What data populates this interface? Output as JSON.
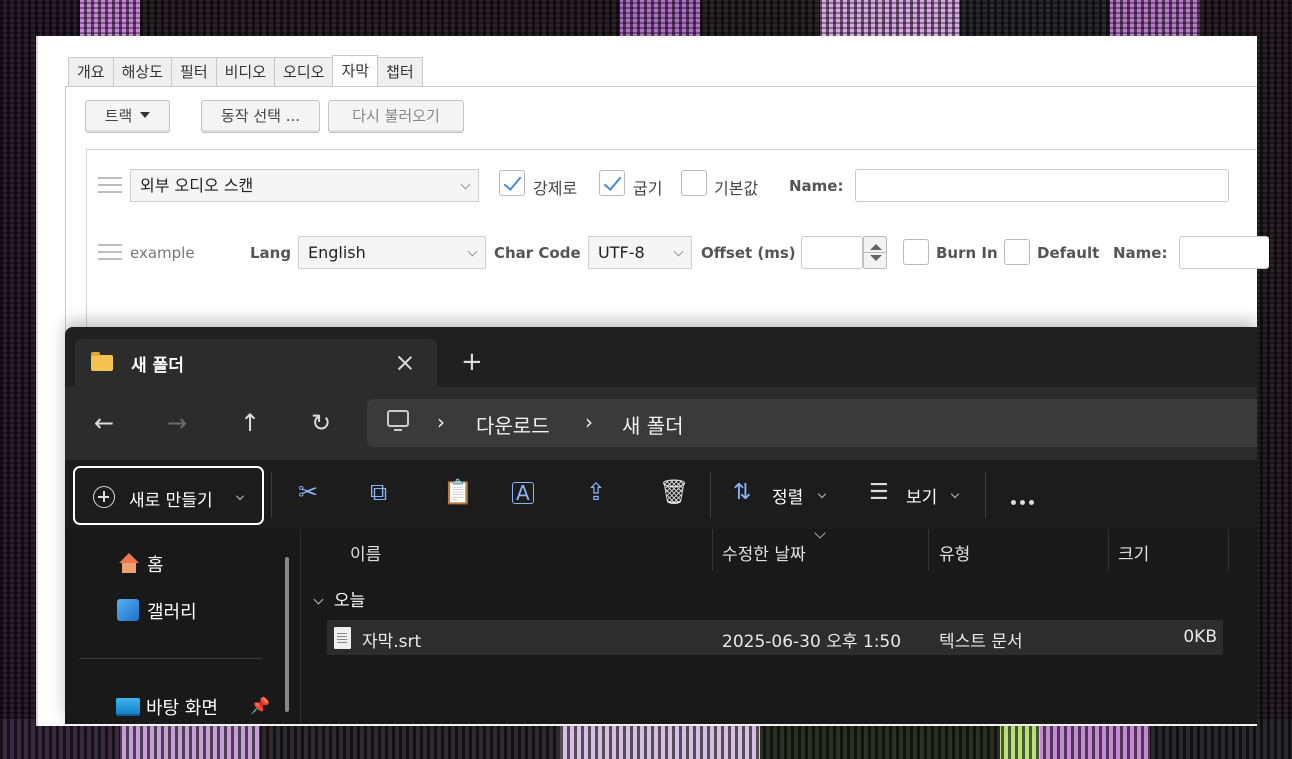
{
  "panel": {
    "tabs": [
      "개요",
      "해상도",
      "필터",
      "비디오",
      "오디오",
      "자막",
      "챕터"
    ],
    "active_tab": "자막",
    "buttons": {
      "track": "트랙",
      "action": "동작 선택 ...",
      "reload": "다시 불러오기"
    },
    "row1": {
      "select_value": "외부 오디오 스캔",
      "forced_label": "강제로",
      "forced_checked": true,
      "bold_label": "굽기",
      "bold_checked": true,
      "default_label": "기본값",
      "default_checked": false,
      "name_label": "Name:",
      "name_value": ""
    },
    "row2": {
      "track_name": "example",
      "lang_label": "Lang",
      "lang_value": "English",
      "charcode_label": "Char Code",
      "charcode_value": "UTF-8",
      "offset_label": "Offset (ms)",
      "offset_value": "",
      "burnin_label": "Burn In",
      "default_label": "Default",
      "name_label": "Name:"
    }
  },
  "explorer": {
    "tab_title": "새 폴더",
    "new_tab_symbol": "+",
    "nav": {
      "back": "←",
      "forward": "→",
      "up": "↑",
      "refresh": "↻"
    },
    "breadcrumb": [
      "다운로드",
      "새 폴더"
    ],
    "breadcrumb_separator": "›",
    "toolbar": {
      "new_label": "새로 만들기",
      "sort_label": "정렬",
      "view_label": "보기",
      "icons": [
        "cut-icon",
        "copy-icon",
        "paste-icon",
        "rename-icon",
        "share-icon",
        "delete-icon"
      ]
    },
    "sidebar": [
      {
        "label": "홈",
        "icon": "home-icon"
      },
      {
        "label": "갤러리",
        "icon": "gallery-icon"
      },
      {
        "label": "바탕 화면",
        "icon": "desktop-icon",
        "pinned": true
      }
    ],
    "columns": [
      "이름",
      "수정한 날짜",
      "유형",
      "크기"
    ],
    "group_label": "오늘",
    "files": [
      {
        "name": "자막.srt",
        "modified": "2025-06-30 오후 1:50",
        "type": "텍스트 문서",
        "size": "0KB"
      }
    ]
  },
  "colors": {
    "accent": "#8ab4f8",
    "focus_border": "#ffffff",
    "explorer_bg": "#1f1f1f"
  }
}
